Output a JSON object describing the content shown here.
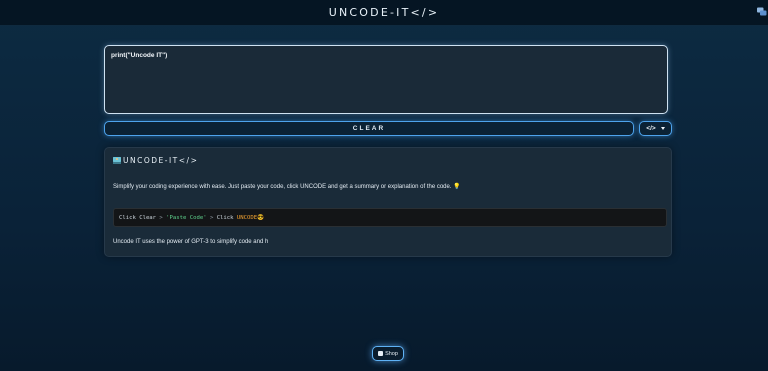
{
  "header": {
    "brand": "UNCODE-IT</>"
  },
  "editor": {
    "value": "print(\"Uncode IT\")"
  },
  "toolbar": {
    "clear_label": "CLEAR",
    "language_selected": "</>"
  },
  "info_card": {
    "title": "UNCODE-IT</>",
    "description": "Simplify your coding experience with ease. Just paste your code, click UNCODE and get a summary or explanation of the code.",
    "description_emoji": "💡",
    "steps": {
      "step1": "Click Clear",
      "sep1": " > ",
      "step2": "'Paste Code'",
      "sep2": " > ",
      "step3_prefix": "Click ",
      "step3_keyword": "UNCODE",
      "step3_emoji": "😎"
    },
    "footer": "Uncode IT uses the power of GPT-3 to simplify code and h"
  },
  "shop": {
    "label": "Shop"
  },
  "icons": {
    "chat": "chat-bubbles-icon",
    "title": "laptop-person-icon",
    "shop": "shop-icon",
    "dropdown": "chevron-down-icon"
  },
  "colors": {
    "background": "#0a2238",
    "accent": "#4ea3ec",
    "string": "#5fd38d",
    "keyword": "#f0a030"
  }
}
